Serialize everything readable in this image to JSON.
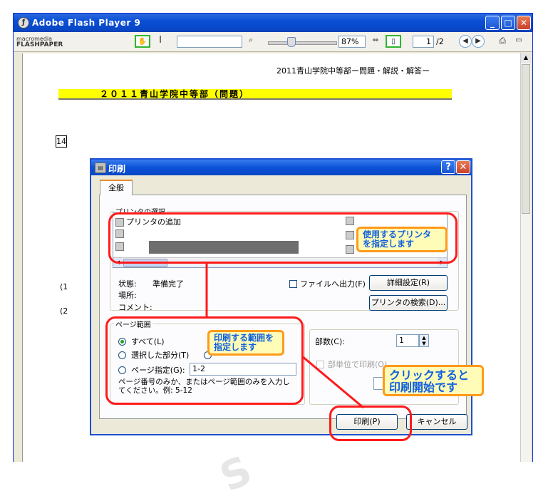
{
  "window": {
    "title": "Adobe Flash Player 9"
  },
  "toolbar": {
    "logo_small": "macromedia",
    "logo_big": "FLASHPAPER",
    "zoom": "87%",
    "page_current": "1",
    "page_total": "/2"
  },
  "document": {
    "header": "2011青山学院中等部ー問題・解説・解答ー",
    "banner": "２０１１青山学院中等部（問題）",
    "question_number": "14",
    "margin_1": "(1",
    "margin_2": "(2"
  },
  "dialog": {
    "title": "印刷",
    "tab_general": "全般",
    "printer_group_label": "プリンタの選択",
    "add_printer": "プリンタの追加",
    "status_label": "状態:",
    "status_value": "準備完了",
    "location_label": "場所:",
    "comment_label": "コメント:",
    "print_to_file": "ファイルへ出力(F)",
    "details_button": "詳細設定(R)",
    "find_printer_button": "プリンタの検索(D)...",
    "page_range_label": "ページ範囲",
    "range_all": "すべて(L)",
    "range_selection": "選択した部分(T)",
    "range_pages": "ページ指定(G):",
    "range_pages_value": "1-2",
    "range_hint": "ページ番号のみか、またはページ範囲のみを入力してください。例: 5-12",
    "copies_label": "部数(C):",
    "copies_value": "1",
    "collate_label": "部単位で印刷(O)",
    "print_button": "印刷(P)",
    "cancel_button": "キャンセル"
  },
  "annotations": {
    "printer_line1": "使用するプリンタ",
    "printer_line2": "を指定します",
    "range_line1": "印刷する範囲を",
    "range_line2": "指定します",
    "click_line1": "クリックすると",
    "click_line2": "印刷開始です"
  }
}
